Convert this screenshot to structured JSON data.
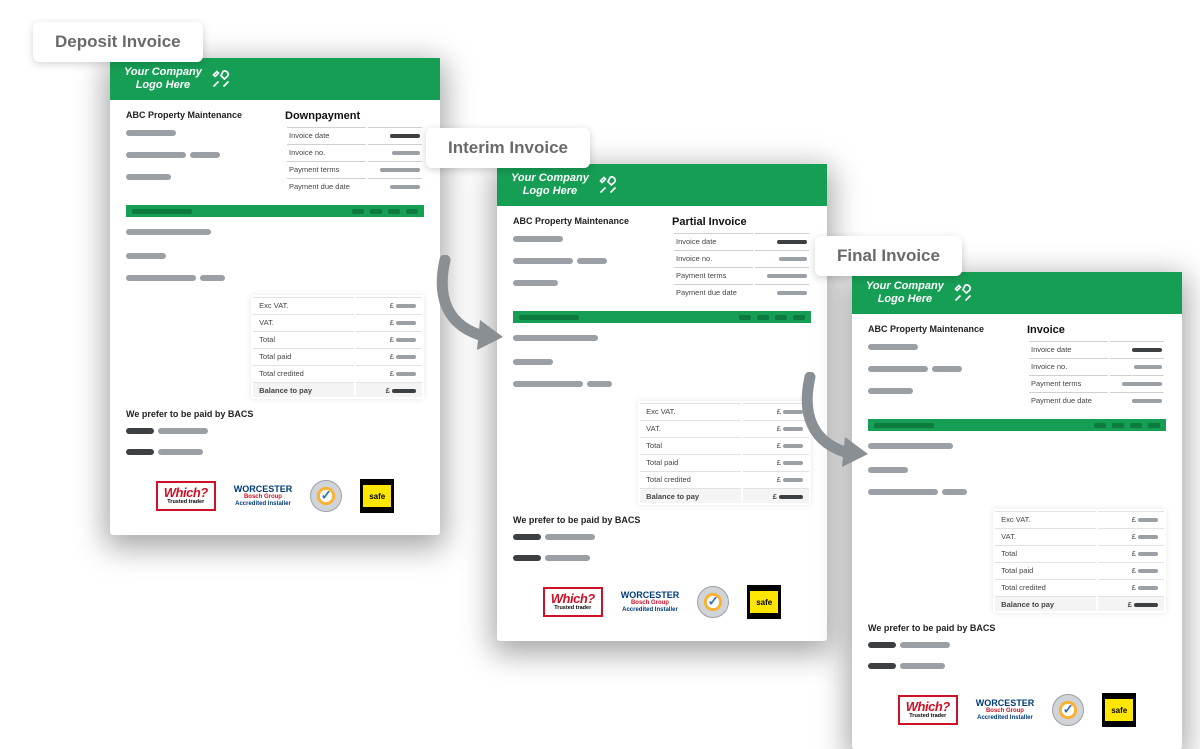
{
  "labels": {
    "deposit": "Deposit Invoice",
    "interim": "Interim Invoice",
    "final": "Final Invoice"
  },
  "header": {
    "logo_line1": "Your Company",
    "logo_line2": "Logo Here"
  },
  "invoice": {
    "company_name": "ABC Property Maintenance",
    "deposit_title": "Downpayment",
    "interim_title": "Partial Invoice",
    "final_title": "Invoice",
    "meta_labels": {
      "invoice_date": "Invoice date",
      "invoice_no": "Invoice no.",
      "payment_terms": "Payment terms",
      "payment_due": "Payment due date"
    },
    "totals_labels": {
      "exc_vat": "Exc VAT.",
      "vat": "VAT.",
      "total": "Total",
      "total_paid": "Total paid",
      "total_credited": "Total credited",
      "balance": "Balance to pay"
    },
    "currency": "£",
    "footer_note": "We prefer to be paid by BACS"
  },
  "badges": {
    "which_text": "Which?",
    "which_sub": "Trusted trader",
    "worcester_title": "WORCESTER",
    "worcester_sub1": "Bosch Group",
    "worcester_sub2": "Accredited Installer",
    "gassafe_text": "safe"
  }
}
